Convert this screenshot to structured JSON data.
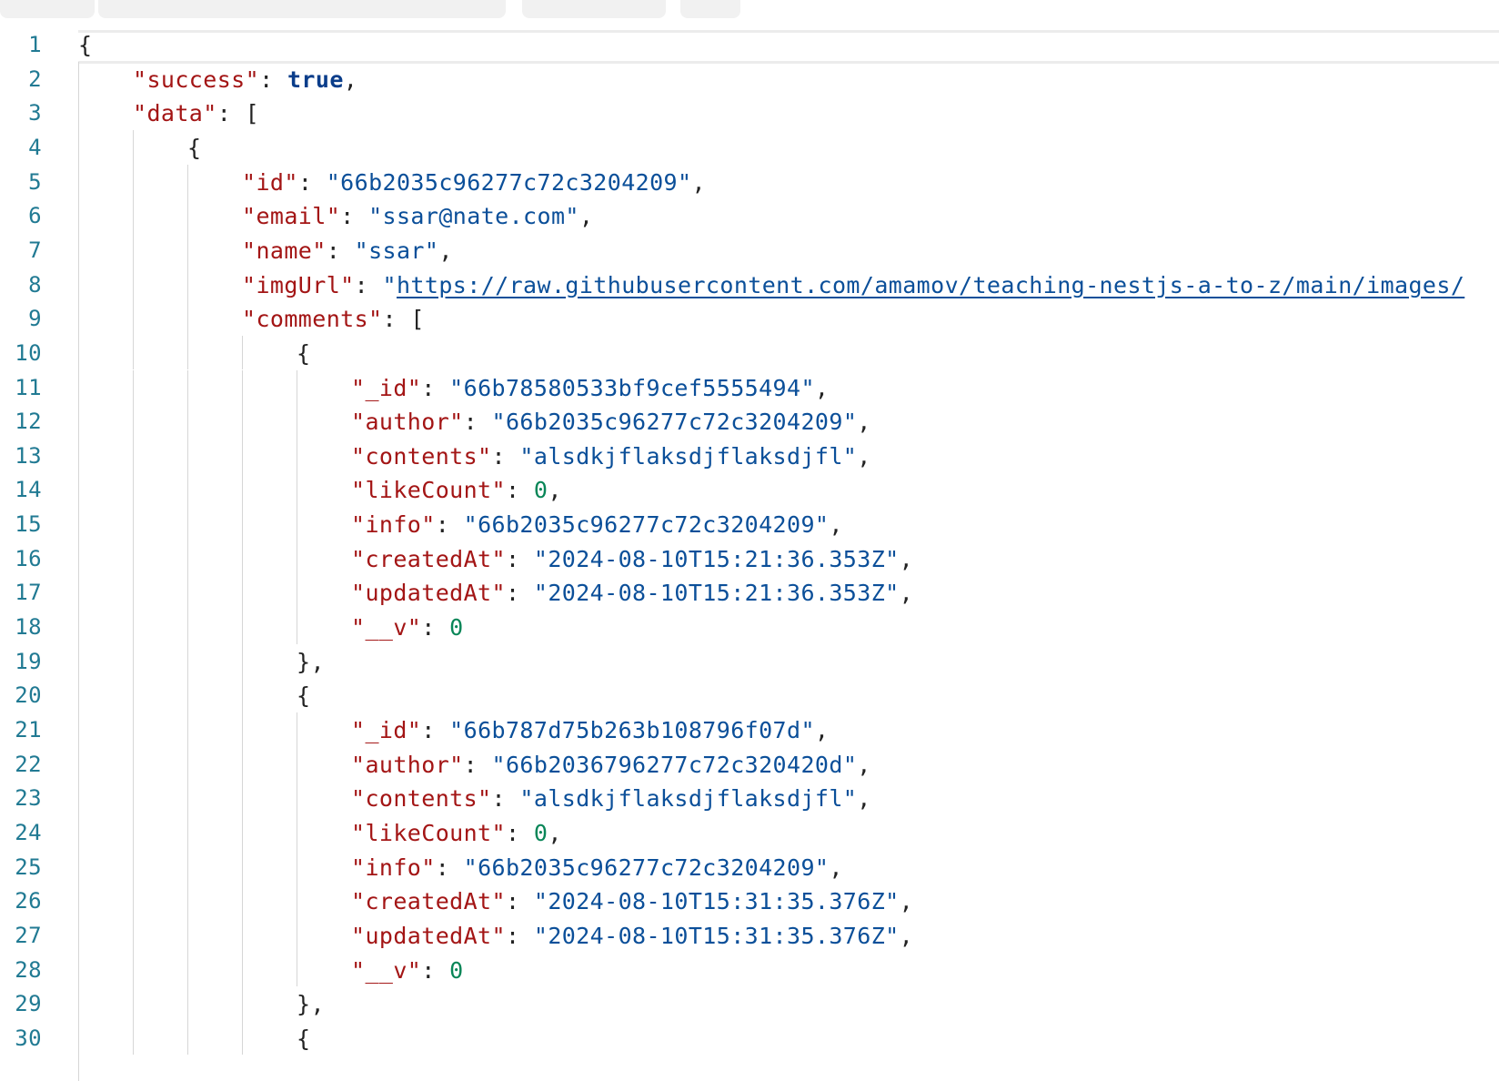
{
  "tabs": [
    "",
    "",
    "",
    ""
  ],
  "lines": [
    {
      "n": "1",
      "indent": 0,
      "tokens": [
        {
          "t": "p",
          "v": "{"
        }
      ]
    },
    {
      "n": "2",
      "indent": 1,
      "tokens": [
        {
          "t": "k",
          "v": "\"success\""
        },
        {
          "t": "p",
          "v": ": "
        },
        {
          "t": "b",
          "v": "true"
        },
        {
          "t": "p",
          "v": ","
        }
      ]
    },
    {
      "n": "3",
      "indent": 1,
      "tokens": [
        {
          "t": "k",
          "v": "\"data\""
        },
        {
          "t": "p",
          "v": ": ["
        }
      ]
    },
    {
      "n": "4",
      "indent": 2,
      "tokens": [
        {
          "t": "p",
          "v": "{"
        }
      ]
    },
    {
      "n": "5",
      "indent": 3,
      "tokens": [
        {
          "t": "k",
          "v": "\"id\""
        },
        {
          "t": "p",
          "v": ": "
        },
        {
          "t": "s",
          "v": "\"66b2035c96277c72c3204209\""
        },
        {
          "t": "p",
          "v": ","
        }
      ]
    },
    {
      "n": "6",
      "indent": 3,
      "tokens": [
        {
          "t": "k",
          "v": "\"email\""
        },
        {
          "t": "p",
          "v": ": "
        },
        {
          "t": "s",
          "v": "\"ssar@nate.com\""
        },
        {
          "t": "p",
          "v": ","
        }
      ]
    },
    {
      "n": "7",
      "indent": 3,
      "tokens": [
        {
          "t": "k",
          "v": "\"name\""
        },
        {
          "t": "p",
          "v": ": "
        },
        {
          "t": "s",
          "v": "\"ssar\""
        },
        {
          "t": "p",
          "v": ","
        }
      ]
    },
    {
      "n": "8",
      "indent": 3,
      "tokens": [
        {
          "t": "k",
          "v": "\"imgUrl\""
        },
        {
          "t": "p",
          "v": ": "
        },
        {
          "t": "s",
          "v": "\""
        },
        {
          "t": "u",
          "v": "https://raw.githubusercontent.com/amamov/teaching-nestjs-a-to-z/main/images/"
        }
      ]
    },
    {
      "n": "9",
      "indent": 3,
      "tokens": [
        {
          "t": "k",
          "v": "\"comments\""
        },
        {
          "t": "p",
          "v": ": ["
        }
      ]
    },
    {
      "n": "10",
      "indent": 4,
      "tokens": [
        {
          "t": "p",
          "v": "{"
        }
      ]
    },
    {
      "n": "11",
      "indent": 5,
      "tokens": [
        {
          "t": "k",
          "v": "\"_id\""
        },
        {
          "t": "p",
          "v": ": "
        },
        {
          "t": "s",
          "v": "\"66b78580533bf9cef5555494\""
        },
        {
          "t": "p",
          "v": ","
        }
      ]
    },
    {
      "n": "12",
      "indent": 5,
      "tokens": [
        {
          "t": "k",
          "v": "\"author\""
        },
        {
          "t": "p",
          "v": ": "
        },
        {
          "t": "s",
          "v": "\"66b2035c96277c72c3204209\""
        },
        {
          "t": "p",
          "v": ","
        }
      ]
    },
    {
      "n": "13",
      "indent": 5,
      "tokens": [
        {
          "t": "k",
          "v": "\"contents\""
        },
        {
          "t": "p",
          "v": ": "
        },
        {
          "t": "s",
          "v": "\"alsdkjflaksdjflaksdjfl\""
        },
        {
          "t": "p",
          "v": ","
        }
      ]
    },
    {
      "n": "14",
      "indent": 5,
      "tokens": [
        {
          "t": "k",
          "v": "\"likeCount\""
        },
        {
          "t": "p",
          "v": ": "
        },
        {
          "t": "n",
          "v": "0"
        },
        {
          "t": "p",
          "v": ","
        }
      ]
    },
    {
      "n": "15",
      "indent": 5,
      "tokens": [
        {
          "t": "k",
          "v": "\"info\""
        },
        {
          "t": "p",
          "v": ": "
        },
        {
          "t": "s",
          "v": "\"66b2035c96277c72c3204209\""
        },
        {
          "t": "p",
          "v": ","
        }
      ]
    },
    {
      "n": "16",
      "indent": 5,
      "tokens": [
        {
          "t": "k",
          "v": "\"createdAt\""
        },
        {
          "t": "p",
          "v": ": "
        },
        {
          "t": "s",
          "v": "\"2024-08-10T15:21:36.353Z\""
        },
        {
          "t": "p",
          "v": ","
        }
      ]
    },
    {
      "n": "17",
      "indent": 5,
      "tokens": [
        {
          "t": "k",
          "v": "\"updatedAt\""
        },
        {
          "t": "p",
          "v": ": "
        },
        {
          "t": "s",
          "v": "\"2024-08-10T15:21:36.353Z\""
        },
        {
          "t": "p",
          "v": ","
        }
      ]
    },
    {
      "n": "18",
      "indent": 5,
      "tokens": [
        {
          "t": "k",
          "v": "\"__v\""
        },
        {
          "t": "p",
          "v": ": "
        },
        {
          "t": "n",
          "v": "0"
        }
      ]
    },
    {
      "n": "19",
      "indent": 4,
      "tokens": [
        {
          "t": "p",
          "v": "},"
        }
      ]
    },
    {
      "n": "20",
      "indent": 4,
      "tokens": [
        {
          "t": "p",
          "v": "{"
        }
      ]
    },
    {
      "n": "21",
      "indent": 5,
      "tokens": [
        {
          "t": "k",
          "v": "\"_id\""
        },
        {
          "t": "p",
          "v": ": "
        },
        {
          "t": "s",
          "v": "\"66b787d75b263b108796f07d\""
        },
        {
          "t": "p",
          "v": ","
        }
      ]
    },
    {
      "n": "22",
      "indent": 5,
      "tokens": [
        {
          "t": "k",
          "v": "\"author\""
        },
        {
          "t": "p",
          "v": ": "
        },
        {
          "t": "s",
          "v": "\"66b2036796277c72c320420d\""
        },
        {
          "t": "p",
          "v": ","
        }
      ]
    },
    {
      "n": "23",
      "indent": 5,
      "tokens": [
        {
          "t": "k",
          "v": "\"contents\""
        },
        {
          "t": "p",
          "v": ": "
        },
        {
          "t": "s",
          "v": "\"alsdkjflaksdjflaksdjfl\""
        },
        {
          "t": "p",
          "v": ","
        }
      ]
    },
    {
      "n": "24",
      "indent": 5,
      "tokens": [
        {
          "t": "k",
          "v": "\"likeCount\""
        },
        {
          "t": "p",
          "v": ": "
        },
        {
          "t": "n",
          "v": "0"
        },
        {
          "t": "p",
          "v": ","
        }
      ]
    },
    {
      "n": "25",
      "indent": 5,
      "tokens": [
        {
          "t": "k",
          "v": "\"info\""
        },
        {
          "t": "p",
          "v": ": "
        },
        {
          "t": "s",
          "v": "\"66b2035c96277c72c3204209\""
        },
        {
          "t": "p",
          "v": ","
        }
      ]
    },
    {
      "n": "26",
      "indent": 5,
      "tokens": [
        {
          "t": "k",
          "v": "\"createdAt\""
        },
        {
          "t": "p",
          "v": ": "
        },
        {
          "t": "s",
          "v": "\"2024-08-10T15:31:35.376Z\""
        },
        {
          "t": "p",
          "v": ","
        }
      ]
    },
    {
      "n": "27",
      "indent": 5,
      "tokens": [
        {
          "t": "k",
          "v": "\"updatedAt\""
        },
        {
          "t": "p",
          "v": ": "
        },
        {
          "t": "s",
          "v": "\"2024-08-10T15:31:35.376Z\""
        },
        {
          "t": "p",
          "v": ","
        }
      ]
    },
    {
      "n": "28",
      "indent": 5,
      "tokens": [
        {
          "t": "k",
          "v": "\"__v\""
        },
        {
          "t": "p",
          "v": ": "
        },
        {
          "t": "n",
          "v": "0"
        }
      ]
    },
    {
      "n": "29",
      "indent": 4,
      "tokens": [
        {
          "t": "p",
          "v": "},"
        }
      ]
    },
    {
      "n": "30",
      "indent": 4,
      "tokens": [
        {
          "t": "p",
          "v": "{"
        }
      ]
    }
  ],
  "colors": {
    "key": "#a31515",
    "string": "#0b4f99",
    "number": "#098658",
    "boolean": "#0a3d8a",
    "line_number": "#217a93"
  }
}
